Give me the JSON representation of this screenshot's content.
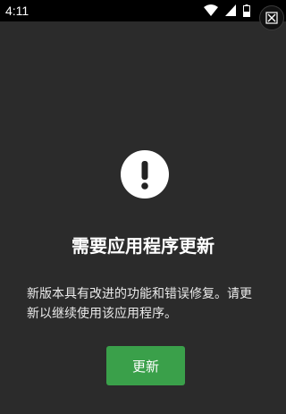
{
  "status_bar": {
    "time": "4:11",
    "icons": [
      "wifi-icon",
      "signal-icon",
      "battery-icon"
    ]
  },
  "dismiss": {
    "icon": "close-icon"
  },
  "dialog": {
    "icon": "exclamation-icon",
    "title": "需要应用程序更新",
    "message": "新版本具有改进的功能和错误修复。请更新以继续使用该应用程序。",
    "update_label": "更新",
    "accent_color": "#3aa04a"
  }
}
